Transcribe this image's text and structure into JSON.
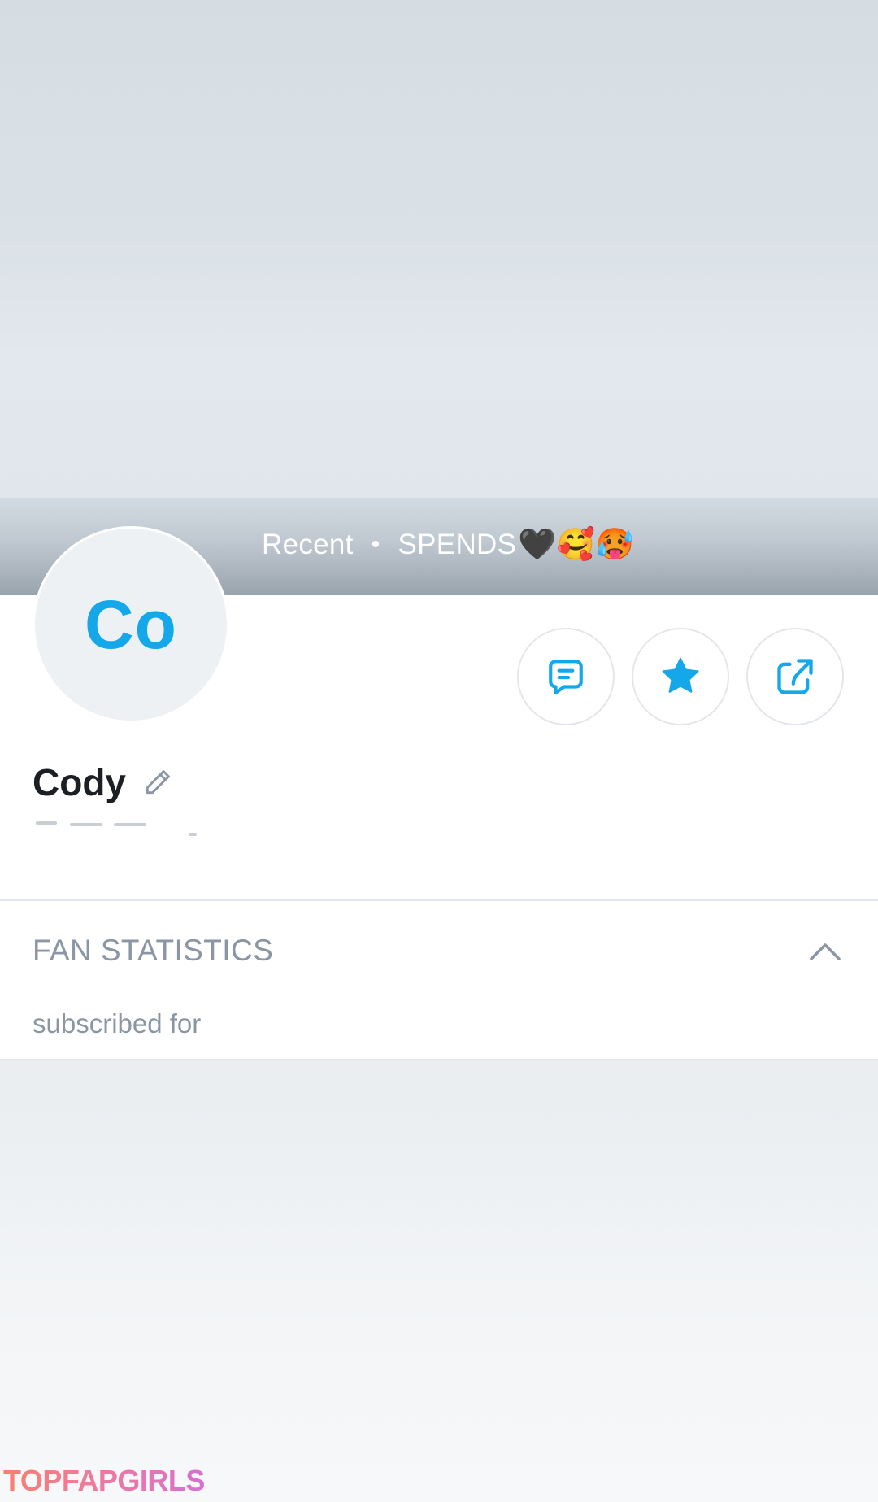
{
  "cover": {
    "meta_status": "Recent",
    "meta_separator": "•",
    "meta_label": "SPENDS",
    "meta_emojis": "🖤🥰🥵"
  },
  "profile": {
    "avatar_initials": "Co",
    "display_name": "Cody"
  },
  "actions": {
    "message_icon": "message-icon",
    "favorite_icon": "star-icon",
    "share_icon": "share-icon"
  },
  "fan_statistics": {
    "title": "FAN STATISTICS",
    "subscribed_label": "subscribed for"
  },
  "watermark": "TOPFAPGIRLS",
  "colors": {
    "accent": "#14a7ea",
    "muted_text": "#8a96a3",
    "divider": "#e2e6ea"
  }
}
